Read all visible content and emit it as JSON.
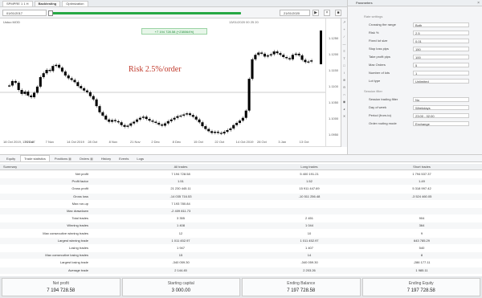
{
  "tabs": [
    "SPMPRE 1 1 H",
    "Backtesting",
    "Optimization"
  ],
  "toolbar": {
    "start_date": "01/01/2017",
    "end_date": "21/01/2020"
  },
  "chart": {
    "symbol": "Ustuo MOD",
    "profit_badge": "+7 194 728.58 (+238064%)",
    "price_top_label": "13/01/2020 00 25 20",
    "annotation": "Risk 2.5%/order",
    "x_ticks": [
      "18 Oct 2019, 17:21:47",
      "26 Oct",
      "7 Nov",
      "14 Oct 2019",
      "28 Oct",
      "8 Nov",
      "21 Nov",
      "2 Dec",
      "8 Dec",
      "15 Oct",
      "22 Oct",
      "14 Oct 2019",
      "28 Oct",
      "3 Jan",
      "13 Oct"
    ],
    "y_ticks": [
      "1.1250",
      "1.1200",
      "1.1150",
      "1.1100",
      "1.1050",
      "1.1000",
      "1.0950"
    ]
  },
  "params_panel": {
    "title": "Parameters",
    "sections": [
      {
        "header": "Rate settings",
        "rows": [
          {
            "label": "Crossing the range",
            "value": "Both"
          },
          {
            "label": "Risk %",
            "value": "2.5"
          },
          {
            "label": "Fixed lot size",
            "value": "0.01"
          },
          {
            "label": "Stop loss pips",
            "value": "150"
          },
          {
            "label": "Take profit pips",
            "value": "100"
          },
          {
            "label": "Max Orders",
            "value": "5"
          },
          {
            "label": "Number of lots",
            "value": "1"
          },
          {
            "label": "Lot type",
            "value": "Unlimited"
          }
        ]
      },
      {
        "header": "Session filter",
        "rows": [
          {
            "label": "Session trading filter",
            "value": "No"
          },
          {
            "label": "Day of week",
            "value": "Weekdays"
          },
          {
            "label": "Period (from-to)",
            "value": "23:00 - 02:00"
          },
          {
            "label": "Order routing mode",
            "value": "Exchange"
          }
        ]
      }
    ]
  },
  "bottom_tabs": [
    {
      "label": "Equity",
      "badge": ""
    },
    {
      "label": "Trade statistics",
      "badge": ""
    },
    {
      "label": "Positions",
      "badge": "0"
    },
    {
      "label": "Orders",
      "badge": "0"
    },
    {
      "label": "History",
      "badge": ""
    },
    {
      "label": "Events",
      "badge": ""
    },
    {
      "label": "Logs",
      "badge": ""
    }
  ],
  "stats_table": {
    "headers": [
      "Summary",
      "All trades",
      "Long trades",
      "Short trades"
    ],
    "rows": [
      [
        "Net profit",
        "7 194 728.58",
        "5 400 191.21",
        "1 794 537.37"
      ],
      [
        "Profit factor",
        "1.51",
        "1.52",
        "1.49"
      ],
      [
        "Gross profit",
        "21 230 445.11",
        "15 911 447.69",
        "5 318 997.42"
      ],
      [
        "Gross loss",
        "-14 035 716.53",
        "-10 511 256.48",
        "-3 524 460.05"
      ],
      [
        "Max run-up",
        "7 193 780.84",
        "",
        ""
      ],
      [
        "Max drawdown",
        "-2 409 811.73",
        "",
        ""
      ],
      [
        "Total trades",
        "3 355",
        "2 451",
        "904"
      ],
      [
        "Winning trades",
        "1 408",
        "1 044",
        "364"
      ],
      [
        "Max consecutive winning trades",
        "12",
        "10",
        "9"
      ],
      [
        "Largest winning trade",
        "1 011 452.97",
        "1 011 452.97",
        "643 785.29"
      ],
      [
        "Losing trades",
        "1 947",
        "1 407",
        "540"
      ],
      [
        "Max consecutive losing trades",
        "15",
        "14",
        "8"
      ],
      [
        "Largest losing trade",
        "-340 059.30",
        "-340 059.30",
        "-286 177.11"
      ],
      [
        "Average trade",
        "2 144.45",
        "2 203.26",
        "1 985.11"
      ]
    ]
  },
  "summary_cards": [
    {
      "label": "Net profit",
      "value": "7 194 728.58"
    },
    {
      "label": "Starting capital",
      "value": "3 000.00"
    },
    {
      "label": "Ending Balance",
      "value": "7 197 728.58"
    },
    {
      "label": "Ending Equity",
      "value": "7 197 728.58"
    }
  ],
  "colors": {
    "accent_green": "#27a844",
    "annotation_red": "#c0392b",
    "candle": "#000000"
  },
  "candles": [
    1.1023,
    1.1031,
    1.1028,
    1.1015,
    1.1008,
    1.1012,
    1.1005,
    1.1002,
    1.101,
    1.1021,
    1.1038,
    1.1045,
    1.1051,
    1.1049,
    1.1058,
    1.106,
    1.1055,
    1.1048,
    1.1041,
    1.1036,
    1.1033,
    1.1029,
    1.1022,
    1.1018,
    1.1014,
    1.1011,
    1.1004,
    1.0998,
    1.0986,
    1.0975,
    1.0969,
    1.0962,
    1.0958,
    1.0961,
    1.0959,
    1.0957,
    1.0952,
    1.0949,
    1.0951,
    1.0955,
    1.0958,
    1.0962,
    1.0965,
    1.0967,
    1.0963,
    1.096,
    1.0958,
    1.0956,
    1.0953,
    1.0951,
    1.0955,
    1.0959,
    1.0962,
    1.0965,
    1.0968,
    1.0969,
    1.0971,
    1.0973,
    1.097,
    1.0967,
    1.0962,
    1.0957,
    1.095,
    1.0945,
    1.0941,
    1.0938,
    1.094,
    1.0938,
    1.0937,
    1.094,
    1.0943,
    1.0946,
    1.0952,
    1.0956,
    1.096,
    1.0965,
    1.0978,
    1.1035,
    1.107,
    1.1078,
    1.1082,
    1.108,
    1.1075,
    1.1077,
    1.1079,
    1.1084,
    1.1081,
    1.1078,
    1.1074,
    1.1072,
    1.107,
    1.1078,
    1.108,
    1.1077,
    1.1069,
    1.1065,
    1.1066,
    1.1068
  ]
}
